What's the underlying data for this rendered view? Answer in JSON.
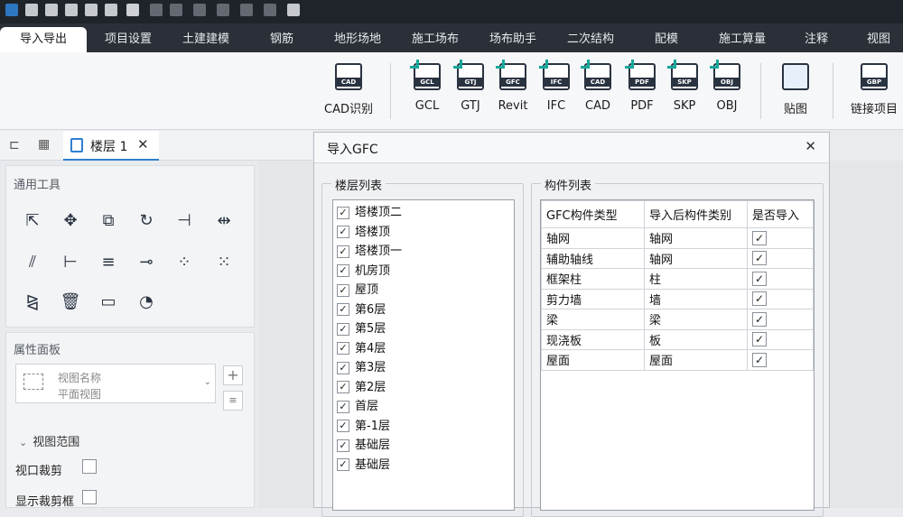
{
  "tabs": [
    "导入导出",
    "项目设置",
    "土建建模",
    "钢筋",
    "地形场地",
    "施工场布",
    "场布助手",
    "二次结构",
    "配模",
    "施工算量",
    "注释",
    "视图"
  ],
  "ribbon": {
    "buttons": [
      {
        "label": "CAD识别",
        "icon": "cad-recognize-icon",
        "tag": "CAD"
      },
      {
        "label": "GCL",
        "icon": "gcl-import-icon",
        "tag": "GCL"
      },
      {
        "label": "GTJ",
        "icon": "gtj-import-icon",
        "tag": "GTJ"
      },
      {
        "label": "Revit",
        "icon": "revit-import-icon",
        "tag": "GFC"
      },
      {
        "label": "IFC",
        "icon": "ifc-import-icon",
        "tag": "IFC"
      },
      {
        "label": "CAD",
        "icon": "cad-import-icon",
        "tag": "CAD"
      },
      {
        "label": "PDF",
        "icon": "pdf-import-icon",
        "tag": "PDF"
      },
      {
        "label": "SKP",
        "icon": "skp-import-icon",
        "tag": "SKP"
      },
      {
        "label": "OBJ",
        "icon": "obj-import-icon",
        "tag": "OBJ"
      },
      {
        "label": "贴图",
        "icon": "texture-icon",
        "tag": ""
      },
      {
        "label": "链接项目",
        "icon": "link-project-icon",
        "tag": "GBP"
      }
    ]
  },
  "doc_tab": {
    "label": "楼层 1",
    "close": "✕"
  },
  "left_panel": {
    "tools_title": "通用工具",
    "tool_icons": [
      "select-icon",
      "move-icon",
      "copy-icon",
      "rotate-icon",
      "trim-extend-icon",
      "split-icon",
      "offset-icon",
      "align-icon",
      "array-icon",
      "break-icon",
      "point-icon",
      "grid-array-icon",
      "mirror-icon",
      "delete-icon",
      "measure-icon",
      "angle-icon"
    ],
    "props_title": "属性面板",
    "view_name_label": "视图名称",
    "view_name_value": "平面视图",
    "view_range_label": "视图范围",
    "viewport_crop_label": "视口裁剪",
    "show_crop_frame_label": "显示裁剪框"
  },
  "dialog": {
    "title": "导入GFC",
    "close": "✕",
    "floor_group_label": "楼层列表",
    "floors": [
      "塔楼顶二",
      "塔楼顶",
      "塔楼顶一",
      "机房顶",
      "屋顶",
      "第6层",
      "第5层",
      "第4层",
      "第3层",
      "第2层",
      "首层",
      "第-1层",
      "基础层",
      "基础层"
    ],
    "comp_group_label": "构件列表",
    "comp_headers": [
      "GFC构件类型",
      "导入后构件类别",
      "是否导入"
    ],
    "comp_rows": [
      {
        "type": "轴网",
        "category": "轴网"
      },
      {
        "type": "辅助轴线",
        "category": "轴网"
      },
      {
        "type": "框架柱",
        "category": "柱"
      },
      {
        "type": "剪力墙",
        "category": "墙"
      },
      {
        "type": "梁",
        "category": "梁"
      },
      {
        "type": "现浇板",
        "category": "板"
      },
      {
        "type": "屋面",
        "category": "屋面"
      }
    ],
    "check_mark": "✓"
  }
}
